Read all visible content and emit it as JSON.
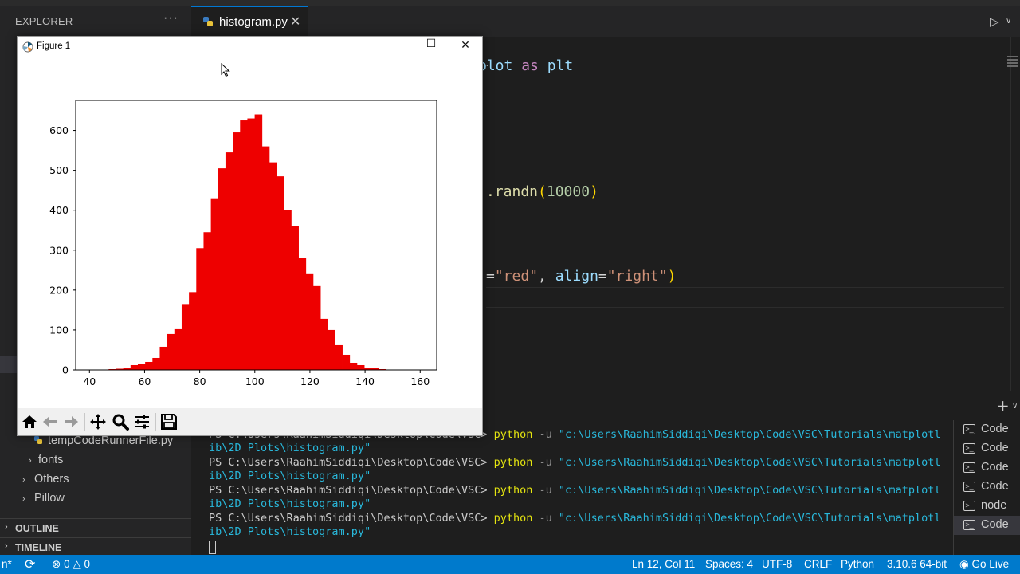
{
  "sidebar": {
    "title": "EXPLORER",
    "more": "···",
    "items": [
      {
        "label": "tempCodeRunnerFile.py",
        "type": "python-file"
      },
      {
        "label": "fonts",
        "type": "folder-collapsed"
      },
      {
        "label": "Others",
        "type": "folder-collapsed"
      },
      {
        "label": "Pillow",
        "type": "folder-collapsed"
      }
    ],
    "sections": [
      {
        "label": "OUTLINE"
      },
      {
        "label": "TIMELINE"
      }
    ]
  },
  "editor": {
    "tab": {
      "label": "histogram.py",
      "close": "✕"
    },
    "breadcrumb_tail": "...",
    "code_fragments": {
      "line1_kw1": "plot",
      "line1_kw2": "as",
      "line1_var": "plt",
      "line2_fn": ".randn",
      "line2_arg": "10000",
      "line3_str1": "\"red\"",
      "line3_param": "align",
      "line3_str2": "\"right\""
    }
  },
  "figure": {
    "title": "Figure 1",
    "window_buttons": {
      "minimize": "—",
      "maximize": "☐",
      "close": "✕"
    },
    "toolbar_icons": [
      "home-icon",
      "back-arrow-icon",
      "forward-arrow-icon",
      "pan-icon",
      "zoom-icon",
      "configure-icon",
      "save-icon"
    ]
  },
  "chart_data": {
    "type": "bar",
    "title": "",
    "xlabel": "",
    "ylabel": "",
    "xlim": [
      35,
      166
    ],
    "ylim": [
      0,
      675
    ],
    "xticks": [
      40,
      60,
      80,
      100,
      120,
      140,
      160
    ],
    "yticks": [
      0,
      100,
      200,
      300,
      400,
      500,
      600
    ],
    "bin_width": 2.65,
    "bar_color": "#ee0000",
    "bin_edges": [
      39,
      41.65,
      44.3,
      46.95,
      49.6,
      52.25,
      54.9,
      57.55,
      60.2,
      62.85,
      65.5,
      68.15,
      70.8,
      73.45,
      76.1,
      78.75,
      81.4,
      84.05,
      86.7,
      89.35,
      92.0,
      94.65,
      97.3,
      99.95,
      102.6,
      105.25,
      107.9,
      110.55,
      113.2,
      115.85,
      118.5,
      121.15,
      123.8,
      126.45,
      129.1,
      131.75,
      134.4,
      137.05,
      139.7,
      142.35,
      145.0,
      147.65,
      150.3,
      152.95,
      155.6
    ],
    "values": [
      1,
      1,
      1,
      2,
      3,
      5,
      12,
      14,
      20,
      30,
      58,
      90,
      102,
      165,
      195,
      305,
      345,
      430,
      505,
      545,
      595,
      625,
      630,
      640,
      560,
      520,
      485,
      400,
      360,
      280,
      240,
      210,
      128,
      100,
      62,
      38,
      18,
      12,
      6,
      4,
      2,
      1,
      1,
      1
    ]
  },
  "terminal": {
    "lines": [
      {
        "prompt": "PS C:\\Users\\RaahimSiddiqi\\Desktop\\Code\\VSC>",
        "cmd": "python",
        "flag": "-u",
        "arg": "\"c:\\Users\\RaahimSiddiqi\\Desktop\\Code\\VSC\\Tutorials\\matplotl",
        "cont": "ib\\2D Plots\\histogram.py\""
      },
      {
        "prompt": "PS C:\\Users\\RaahimSiddiqi\\Desktop\\Code\\VSC>",
        "cmd": "python",
        "flag": "-u",
        "arg": "\"c:\\Users\\RaahimSiddiqi\\Desktop\\Code\\VSC\\Tutorials\\matplotl",
        "cont": "ib\\2D Plots\\histogram.py\""
      },
      {
        "prompt": "PS C:\\Users\\RaahimSiddiqi\\Desktop\\Code\\VSC>",
        "cmd": "python",
        "flag": "-u",
        "arg": "\"c:\\Users\\RaahimSiddiqi\\Desktop\\Code\\VSC\\Tutorials\\matplotl",
        "cont": "ib\\2D Plots\\histogram.py\""
      },
      {
        "prompt": "PS C:\\Users\\RaahimSiddiqi\\Desktop\\Code\\VSC>",
        "cmd": "python",
        "flag": "-u",
        "arg": "\"c:\\Users\\RaahimSiddiqi\\Desktop\\Code\\VSC\\Tutorials\\matplotl",
        "cont": "ib\\2D Plots\\histogram.py\""
      }
    ],
    "sessions": [
      {
        "label": "Code"
      },
      {
        "label": "Code"
      },
      {
        "label": "Code"
      },
      {
        "label": "Code"
      },
      {
        "label": "node"
      },
      {
        "label": "Code",
        "active": true
      }
    ],
    "add": "+"
  },
  "statusbar": {
    "left_edge": "n*",
    "errors": "0",
    "warnings": "0",
    "position": "Ln 12, Col 11",
    "spaces": "Spaces: 4",
    "encoding": "UTF-8",
    "eol": "CRLF",
    "language": "Python",
    "interpreter": "3.10.6 64-bit",
    "golive": "Go Live"
  },
  "colors": {
    "statusbar": "#007acc",
    "accent": "#0078d4",
    "bars": "#ee0000"
  }
}
